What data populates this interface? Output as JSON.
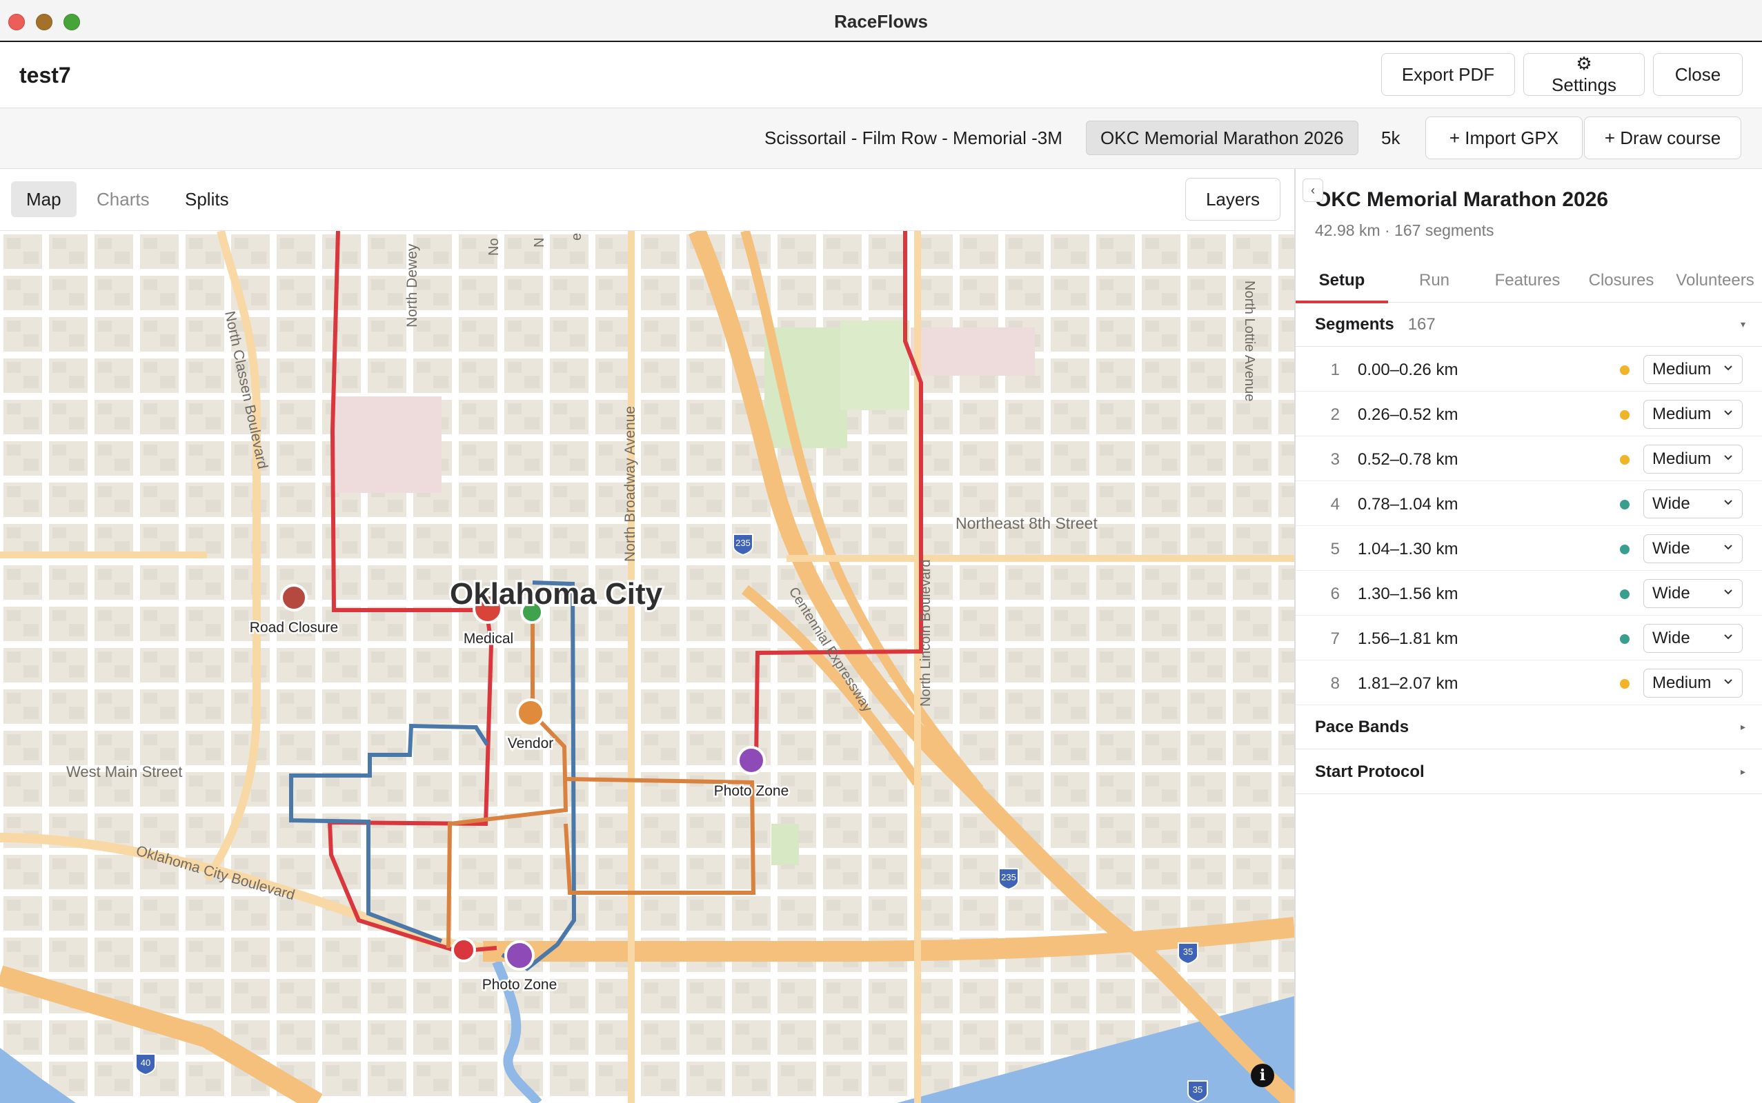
{
  "window": {
    "title": "RaceFlows"
  },
  "header": {
    "project_name": "test7",
    "export_label": "Export PDF",
    "settings_label": "⚙ Settings",
    "close_label": "Close"
  },
  "courses": {
    "tabs": [
      "Scissortail - Film Row - Memorial -3M",
      "OKC Memorial Marathon 2026",
      "5k"
    ],
    "selected": "OKC Memorial Marathon 2026",
    "import_label": "+ Import GPX",
    "draw_label": "+ Draw course"
  },
  "view_tabs": {
    "map": "Map",
    "charts": "Charts",
    "splits": "Splits",
    "selected": "Map"
  },
  "layers_label": "Layers",
  "map": {
    "city_label": "Oklahoma City",
    "street_labels": [
      "North Classen Boulevard",
      "North Dewey",
      "North Broadway Avenue",
      "Northeast 8th Street",
      "Centennial Expressway",
      "North Lincoln Boulevard",
      "North Lottie Avenue",
      "West Main Street",
      "Oklahoma City Boulevard",
      "No",
      "N",
      "e"
    ],
    "highway_shields": [
      "235",
      "235",
      "35",
      "35",
      "40"
    ],
    "markers": [
      {
        "label": "Road Closure",
        "color": "#b5493f"
      },
      {
        "label": "Medical",
        "color": "#d9443a"
      },
      {
        "label": "",
        "color": "#3fa34d"
      },
      {
        "label": "Vendor",
        "color": "#e08a3c"
      },
      {
        "label": "Photo Zone",
        "color": "#8e4bb8"
      },
      {
        "label": "",
        "color": "#d9363e"
      },
      {
        "label": "Photo Zone",
        "color": "#8e4bb8"
      }
    ],
    "route_colors": {
      "red": "#d9363e",
      "blue": "#4a78a8",
      "orange": "#d9823f"
    },
    "info_icon": "info-icon"
  },
  "panel": {
    "collapse_icon": "‹",
    "title": "OKC Memorial Marathon 2026",
    "distance": "42.98 km",
    "segments_meta": " · 167 segments",
    "tabs": [
      "Setup",
      "Run",
      "Features",
      "Closures",
      "Volunteers"
    ],
    "active_tab": "Setup",
    "segments_label": "Segments",
    "segments_count": "167",
    "segments": [
      {
        "n": "1",
        "range": "0.00–0.26 km",
        "width": "Medium",
        "color": "#f0b429"
      },
      {
        "n": "2",
        "range": "0.26–0.52 km",
        "width": "Medium",
        "color": "#f0b429"
      },
      {
        "n": "3",
        "range": "0.52–0.78 km",
        "width": "Medium",
        "color": "#f0b429"
      },
      {
        "n": "4",
        "range": "0.78–1.04 km",
        "width": "Wide",
        "color": "#3a9e8f"
      },
      {
        "n": "5",
        "range": "1.04–1.30 km",
        "width": "Wide",
        "color": "#3a9e8f"
      },
      {
        "n": "6",
        "range": "1.30–1.56 km",
        "width": "Wide",
        "color": "#3a9e8f"
      },
      {
        "n": "7",
        "range": "1.56–1.81 km",
        "width": "Wide",
        "color": "#3a9e8f"
      },
      {
        "n": "8",
        "range": "1.81–2.07 km",
        "width": "Medium",
        "color": "#f0b429"
      }
    ],
    "pace_bands_label": "Pace Bands",
    "start_protocol_label": "Start Protocol",
    "expanded_tri": "▾",
    "collapsed_tri": "▸"
  }
}
